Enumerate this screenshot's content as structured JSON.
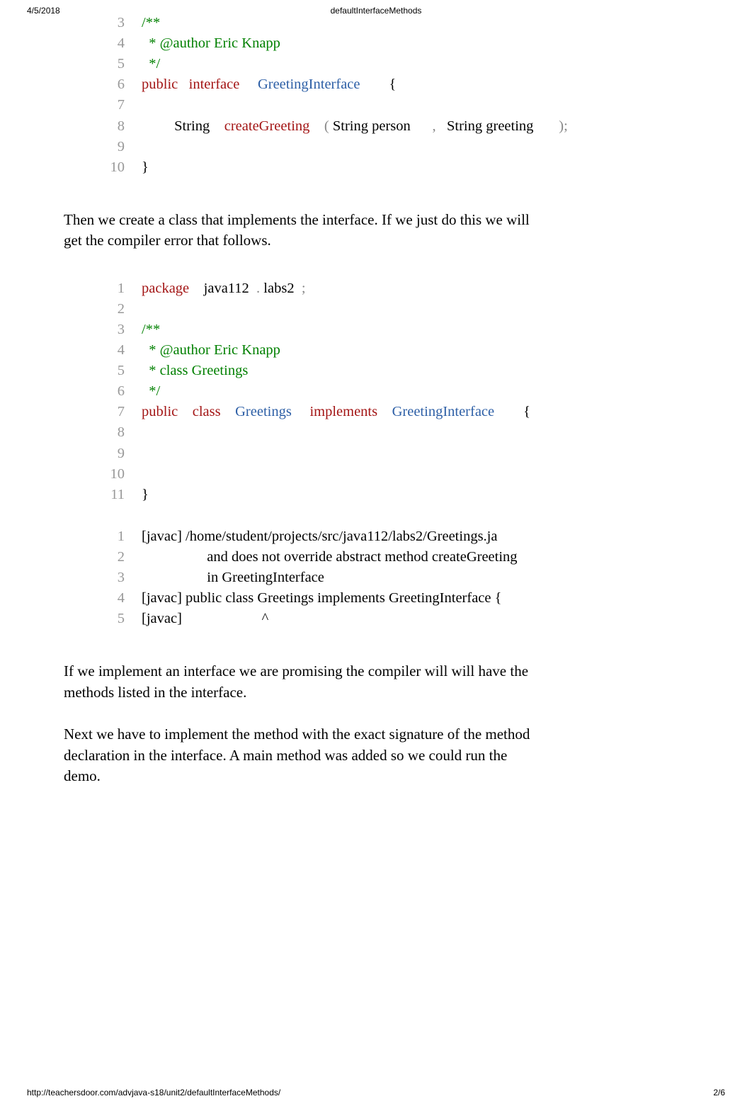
{
  "header": {
    "date": "4/5/2018",
    "title": "defaultInterfaceMethods"
  },
  "code1": {
    "lines": [
      {
        "n": "3",
        "tokens": [
          {
            "t": "/**",
            "c": "comment"
          }
        ]
      },
      {
        "n": "4",
        "tokens": [
          {
            "t": "  * @author Eric Knapp",
            "c": "comment"
          }
        ]
      },
      {
        "n": "5",
        "tokens": [
          {
            "t": "  */",
            "c": "comment"
          }
        ]
      },
      {
        "n": "6",
        "tokens": [
          {
            "t": "public",
            "c": "keyword"
          },
          {
            "t": "   ",
            "c": "plain"
          },
          {
            "t": "interface",
            "c": "keyword"
          },
          {
            "t": "     ",
            "c": "plain"
          },
          {
            "t": "GreetingInterface",
            "c": "type"
          },
          {
            "t": "        ",
            "c": "plain"
          },
          {
            "t": "{",
            "c": "plain"
          }
        ]
      },
      {
        "n": "7",
        "tokens": []
      },
      {
        "n": "8",
        "tokens": [
          {
            "t": "         ",
            "c": "plain"
          },
          {
            "t": "String",
            "c": "plain"
          },
          {
            "t": "    ",
            "c": "plain"
          },
          {
            "t": "createGreeting",
            "c": "method"
          },
          {
            "t": "    ",
            "c": "plain"
          },
          {
            "t": "(",
            "c": "punct"
          },
          {
            "t": " ",
            "c": "plain"
          },
          {
            "t": "String person",
            "c": "plain"
          },
          {
            "t": "      ",
            "c": "plain"
          },
          {
            "t": ",",
            "c": "punct"
          },
          {
            "t": "   ",
            "c": "plain"
          },
          {
            "t": "String greeting",
            "c": "plain"
          },
          {
            "t": "       ",
            "c": "plain"
          },
          {
            "t": ");",
            "c": "punct"
          }
        ]
      },
      {
        "n": "9",
        "tokens": []
      },
      {
        "n": "10",
        "tokens": [
          {
            "t": "}",
            "c": "plain"
          }
        ]
      }
    ]
  },
  "prose1": "Then we create a class that implements the interface. If we just do this we will get the compiler error that follows.",
  "code2": {
    "lines": [
      {
        "n": "1",
        "tokens": [
          {
            "t": "package",
            "c": "package"
          },
          {
            "t": "    ",
            "c": "plain"
          },
          {
            "t": "java112",
            "c": "plain"
          },
          {
            "t": "  ",
            "c": "plain"
          },
          {
            "t": ".",
            "c": "punct"
          },
          {
            "t": " ",
            "c": "plain"
          },
          {
            "t": "labs2",
            "c": "plain"
          },
          {
            "t": "  ",
            "c": "plain"
          },
          {
            "t": ";",
            "c": "punct"
          }
        ]
      },
      {
        "n": "2",
        "tokens": []
      },
      {
        "n": "3",
        "tokens": [
          {
            "t": "/**",
            "c": "comment"
          }
        ]
      },
      {
        "n": "4",
        "tokens": [
          {
            "t": "  * @author Eric Knapp",
            "c": "comment"
          }
        ]
      },
      {
        "n": "5",
        "tokens": [
          {
            "t": "  * class Greetings",
            "c": "comment"
          }
        ]
      },
      {
        "n": "6",
        "tokens": [
          {
            "t": "  */",
            "c": "comment"
          }
        ]
      },
      {
        "n": "7",
        "tokens": [
          {
            "t": "public",
            "c": "keyword"
          },
          {
            "t": "    ",
            "c": "plain"
          },
          {
            "t": "class",
            "c": "keyword"
          },
          {
            "t": "    ",
            "c": "plain"
          },
          {
            "t": "Greetings",
            "c": "type"
          },
          {
            "t": "     ",
            "c": "plain"
          },
          {
            "t": "implements",
            "c": "keyword"
          },
          {
            "t": "    ",
            "c": "plain"
          },
          {
            "t": "GreetingInterface",
            "c": "type"
          },
          {
            "t": "        ",
            "c": "plain"
          },
          {
            "t": "{",
            "c": "plain"
          }
        ]
      },
      {
        "n": "8",
        "tokens": []
      },
      {
        "n": "9",
        "tokens": []
      },
      {
        "n": "10",
        "tokens": []
      },
      {
        "n": "11",
        "tokens": [
          {
            "t": "}",
            "c": "plain"
          }
        ]
      }
    ]
  },
  "code3": {
    "lines": [
      {
        "n": "1",
        "tokens": [
          {
            "t": "[javac] /home/student/projects/src/java112/labs2/Greetings.ja",
            "c": "plain"
          }
        ]
      },
      {
        "n": "2",
        "tokens": [
          {
            "t": "                  and does not override abstract method createGreeting",
            "c": "plain"
          }
        ]
      },
      {
        "n": "3",
        "tokens": [
          {
            "t": "                  in GreetingInterface",
            "c": "plain"
          }
        ]
      },
      {
        "n": "4",
        "tokens": [
          {
            "t": "[javac] public class Greetings implements GreetingInterface {",
            "c": "plain"
          }
        ]
      },
      {
        "n": "5",
        "tokens": [
          {
            "t": "[javac]                      ^",
            "c": "plain"
          }
        ]
      }
    ]
  },
  "prose2": "If we implement an interface we are promising the compiler will will have the methods listed in the interface.",
  "prose3_a": "Next we have to implement the method with the exact signature of the method declaration in the interface. A ",
  "prose3_code": "   main ",
  "prose3_b": " method was added so we could run the demo.",
  "footer": {
    "url": "http://teachersdoor.com/advjava-s18/unit2/defaultInterfaceMethods/",
    "pagenum": "2/6"
  }
}
